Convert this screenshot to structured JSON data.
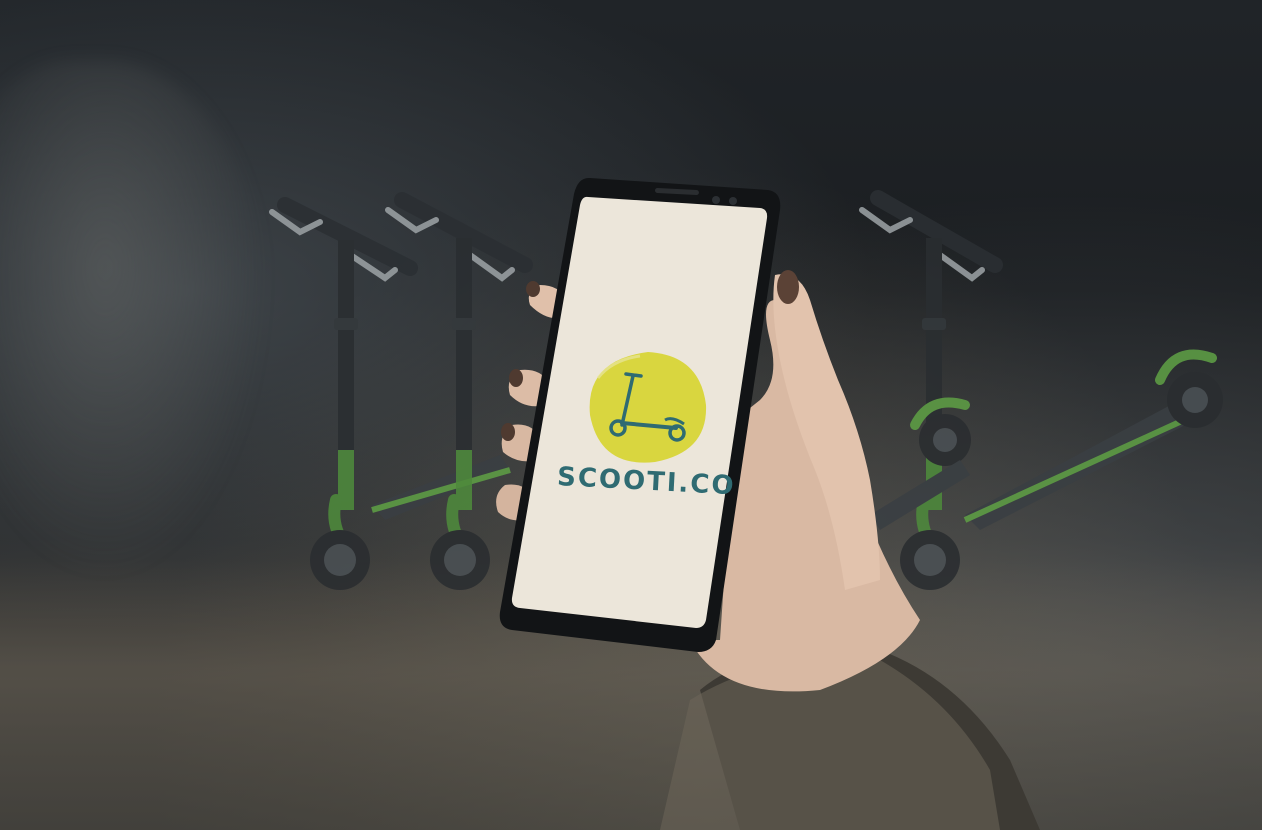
{
  "image": {
    "description_colors": {
      "screen_background": "#ece6da",
      "logo_circle": "#d9d63f",
      "brand_text": "#2f6b72",
      "scooter_accent": "#5e9e45",
      "scooter_body": "#2a2e31"
    }
  },
  "phone": {
    "logo": {
      "icon": "scooter-icon",
      "brand_name": "SCOOTI.CO"
    }
  }
}
